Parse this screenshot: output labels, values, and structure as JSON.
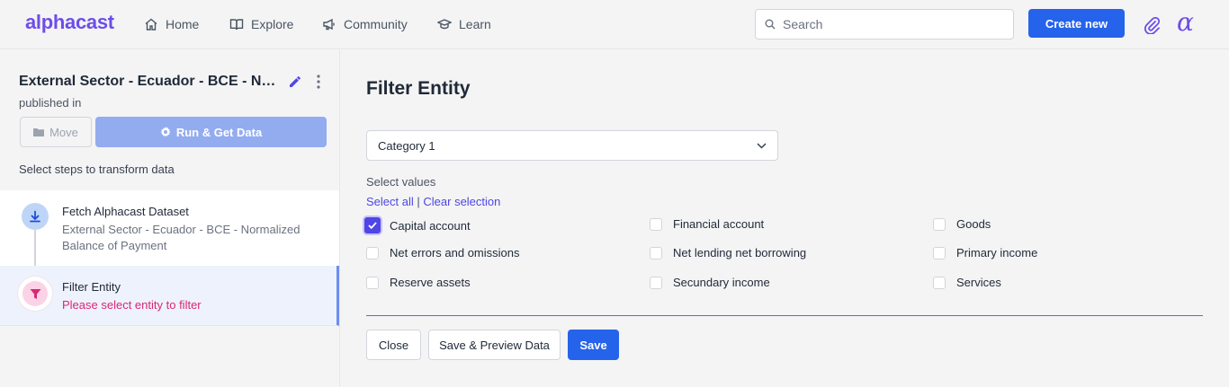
{
  "header": {
    "logo": "alphacast",
    "nav": [
      {
        "label": "Home",
        "icon": "home-icon"
      },
      {
        "label": "Explore",
        "icon": "book-icon"
      },
      {
        "label": "Community",
        "icon": "megaphone-icon"
      },
      {
        "label": "Learn",
        "icon": "graduation-cap-icon"
      }
    ],
    "search_placeholder": "Search",
    "create_label": "Create new",
    "accent": "#6d4ee8",
    "primary": "#2563eb"
  },
  "sidebar": {
    "dataset_title": "External Sector - Ecuador - BCE - Normalized Balance of Payment",
    "published_in": "published in",
    "move_label": "Move",
    "run_label": "Run & Get Data",
    "steps_hint": "Select steps to transform data",
    "steps": [
      {
        "title": "Fetch Alphacast Dataset",
        "desc": "External Sector - Ecuador - BCE - Normalized Balance of Payment"
      },
      {
        "title": "Filter Entity",
        "warning": "Please select entity to filter"
      }
    ]
  },
  "main": {
    "title": "Filter Entity",
    "select_value": "Category 1",
    "select_values_label": "Select values",
    "select_all": "Select all",
    "separator": "|",
    "clear_selection": "Clear selection",
    "options": [
      {
        "label": "Capital account",
        "checked": true
      },
      {
        "label": "Financial account",
        "checked": false
      },
      {
        "label": "Goods",
        "checked": false
      },
      {
        "label": "Net errors and omissions",
        "checked": false
      },
      {
        "label": "Net lending net borrowing",
        "checked": false
      },
      {
        "label": "Primary income",
        "checked": false
      },
      {
        "label": "Reserve assets",
        "checked": false
      },
      {
        "label": "Secundary income",
        "checked": false
      },
      {
        "label": "Services",
        "checked": false
      }
    ],
    "close_label": "Close",
    "preview_label": "Save & Preview Data",
    "save_label": "Save"
  }
}
